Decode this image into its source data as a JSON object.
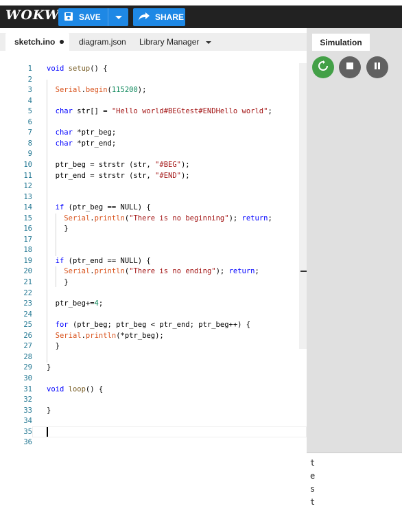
{
  "header": {
    "logo": "WOKWi",
    "save_label": "SAVE",
    "share_label": "SHARE"
  },
  "tabs": [
    {
      "label": "sketch.ino"
    },
    {
      "label": "diagram.json"
    },
    {
      "label": "Library Manager"
    }
  ],
  "code": {
    "line_numbers": [
      "1",
      "2",
      "3",
      "4",
      "5",
      "6",
      "7",
      "8",
      "9",
      "10",
      "11",
      "12",
      "13",
      "14",
      "15",
      "16",
      "17",
      "18",
      "19",
      "20",
      "21",
      "22",
      "23",
      "24",
      "25",
      "26",
      "27",
      "28",
      "29",
      "30",
      "31",
      "32",
      "33",
      "34",
      "35",
      "36"
    ],
    "lines": [
      "void setup() {",
      "",
      "  Serial.begin(115200);",
      "",
      "  char str[] = \"Hello world#BEGtest#ENDHello world\";",
      "",
      "  char *ptr_beg;",
      "  char *ptr_end;",
      "",
      "  ptr_beg = strstr (str, \"#BEG\");",
      "  ptr_end = strstr (str, \"#END\");",
      "",
      "",
      "  if (ptr_beg == NULL) {",
      "    Serial.println(\"There is no beginning\"); return;",
      "    }",
      "",
      "",
      "  if (ptr_end == NULL) {",
      "    Serial.println(\"There is no ending\"); return;",
      "    }",
      "",
      "  ptr_beg+=4;",
      "",
      "  for (ptr_beg; ptr_beg < ptr_end; ptr_beg++) {",
      "  Serial.println(*ptr_beg);",
      "  }",
      "",
      "}",
      "",
      "void loop() {",
      "",
      "}",
      "",
      "",
      ""
    ]
  },
  "simulation": {
    "tab_label": "Simulation"
  },
  "serial_output": [
    "t",
    "e",
    "s",
    "t"
  ],
  "colors": {
    "accent": "#1e88e5",
    "restart": "#43a047",
    "stop": "#616161"
  }
}
